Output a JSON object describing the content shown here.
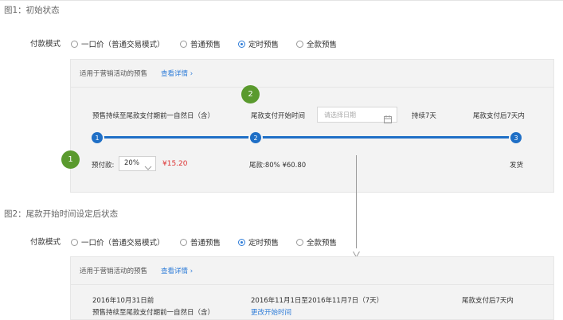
{
  "fig1": {
    "title": "图1：初始状态",
    "payment_label": "付款模式",
    "options": [
      {
        "label": "一口价（普通交易模式）",
        "checked": false
      },
      {
        "label": "普通预售",
        "checked": false
      },
      {
        "label": "定时预售",
        "checked": true
      },
      {
        "label": "全款预售",
        "checked": false
      }
    ],
    "hint": "适用于营销活动的预售",
    "detail_link": "查看详情 ›",
    "left_desc": "预售持续至尾款支付期前一自然日（含）",
    "start_label": "尾款支付开始时间",
    "date_placeholder": "请选择日期",
    "duration": "持续7天",
    "deadline": "尾款支付后7天内",
    "nodes": [
      "1",
      "2",
      "3"
    ],
    "deposit_label": "预付款:",
    "deposit_select": "20%",
    "deposit_amount": "¥15.20",
    "balance": "尾款:80%  ¥60.80",
    "ship": "发货",
    "badge_1": "1",
    "badge_2": "2"
  },
  "fig2": {
    "title": "图2：尾款开始时间设定后状态",
    "payment_label": "付款模式",
    "options": [
      {
        "label": "一口价（普通交易模式）",
        "checked": false
      },
      {
        "label": "普通预售",
        "checked": false
      },
      {
        "label": "定时预售",
        "checked": true
      },
      {
        "label": "全款预售",
        "checked": false
      }
    ],
    "hint": "适用于营销活动的预售",
    "detail_link": "查看详情 ›",
    "date_before": "2016年10月31日前",
    "left_desc": "预售持续至尾款支付期前一自然日（含）",
    "date_range": "2016年11月1日至2016年11月7日（7天）",
    "change_link": "更改开始时间",
    "deadline": "尾款支付后7天内"
  },
  "colors": {
    "accent": "#2e7cd8",
    "timeline": "#1f6fc6",
    "badge": "#5a9a2e",
    "price": "#d33333"
  }
}
